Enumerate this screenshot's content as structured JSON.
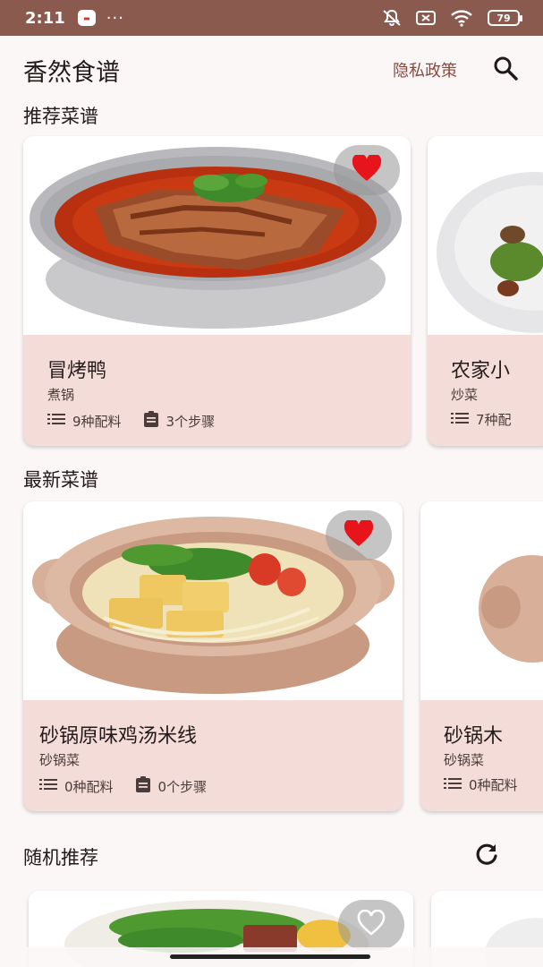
{
  "status_bar": {
    "time": "2:11",
    "dots": "···",
    "battery": "79",
    "app_badge_icon": "news-app-icon"
  },
  "appbar": {
    "title": "香然食谱",
    "privacy_label": "隐私政策"
  },
  "sections": {
    "recommended": "推荐菜谱",
    "latest": "最新菜谱",
    "random": "随机推荐"
  },
  "recommended_cards": [
    {
      "name": "冒烤鸭",
      "category": "煮锅",
      "ingredients": "9种配料",
      "steps": "3个步骤",
      "favorited": true
    },
    {
      "name": "农家小",
      "category": "炒菜",
      "ingredients": "7种配",
      "steps": "",
      "favorited": false
    }
  ],
  "latest_cards": [
    {
      "name": "砂锅原味鸡汤米线",
      "category": "砂锅菜",
      "ingredients": "0种配料",
      "steps": "0个步骤",
      "favorited": true
    },
    {
      "name": "砂锅木",
      "category": "砂锅菜",
      "ingredients": "0种配料",
      "steps": "",
      "favorited": false
    }
  ],
  "random_cards": [
    {
      "favorited": false
    }
  ],
  "colors": {
    "status_bar": "#8a5a4f",
    "card_bg": "#f4dcd8",
    "accent": "#8a4a3f",
    "heart": "#e8141c"
  }
}
